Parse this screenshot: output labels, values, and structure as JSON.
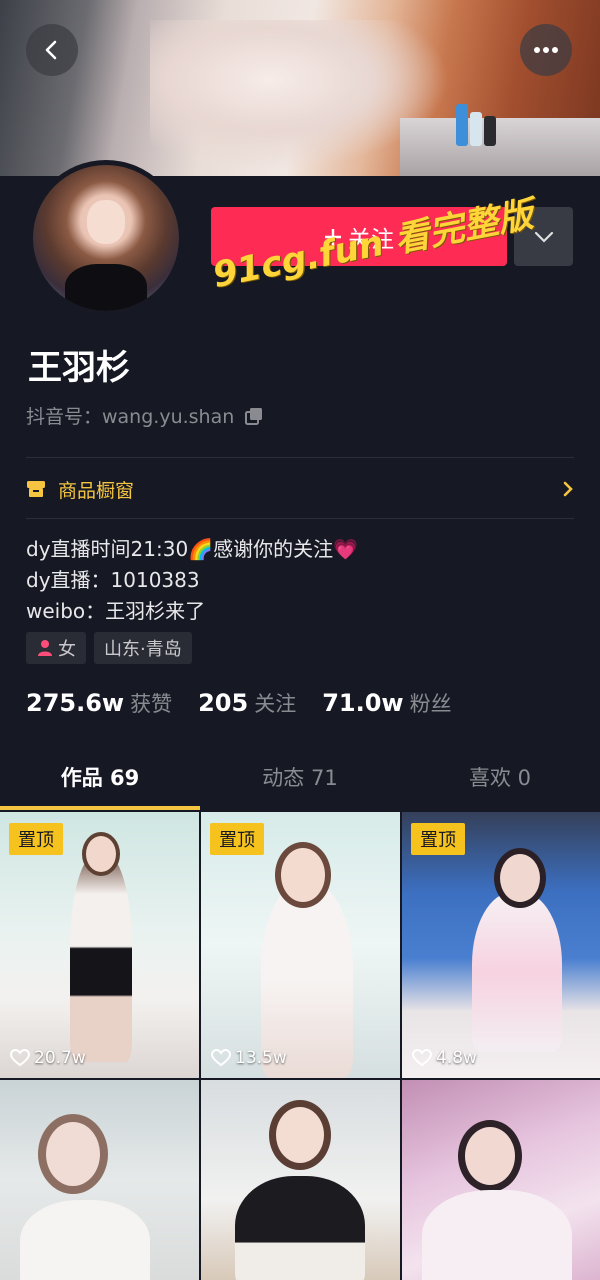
{
  "profile": {
    "name": "王羽杉",
    "id_label": "抖音号：wang.yu.shan",
    "follow_label": "关注",
    "shop_label": "商品橱窗",
    "bio": [
      "dy直播时间21:30🌈感谢你的关注💗",
      "dy直播：1010383",
      "weibo：王羽杉来了"
    ],
    "tags": [
      {
        "icon": "female-icon",
        "label": "女"
      },
      {
        "label": "山东·青岛"
      }
    ],
    "stats": [
      {
        "value": "275.6w",
        "label": "获赞"
      },
      {
        "value": "205",
        "label": "关注"
      },
      {
        "value": "71.0w",
        "label": "粉丝"
      }
    ]
  },
  "watermark": "91cg.fun 看完整版",
  "tabs": [
    {
      "label": "作品 69",
      "active": true
    },
    {
      "label": "动态 71",
      "active": false
    },
    {
      "label": "喜欢 0",
      "active": false
    }
  ],
  "videos": [
    {
      "pinned": true,
      "pin_label": "置顶",
      "likes": "20.7w"
    },
    {
      "pinned": true,
      "pin_label": "置顶",
      "likes": "13.5w"
    },
    {
      "pinned": true,
      "pin_label": "置顶",
      "likes": "4.8w"
    },
    {
      "pinned": false
    },
    {
      "pinned": false
    },
    {
      "pinned": false
    }
  ],
  "colors": {
    "background": "#161823",
    "follow": "#fe2c55",
    "accent": "#f5c542"
  },
  "icons": [
    "back-icon",
    "more-icon",
    "chevron-down-icon",
    "copy-icon",
    "shop-icon",
    "chevron-right-icon",
    "heart-icon"
  ]
}
